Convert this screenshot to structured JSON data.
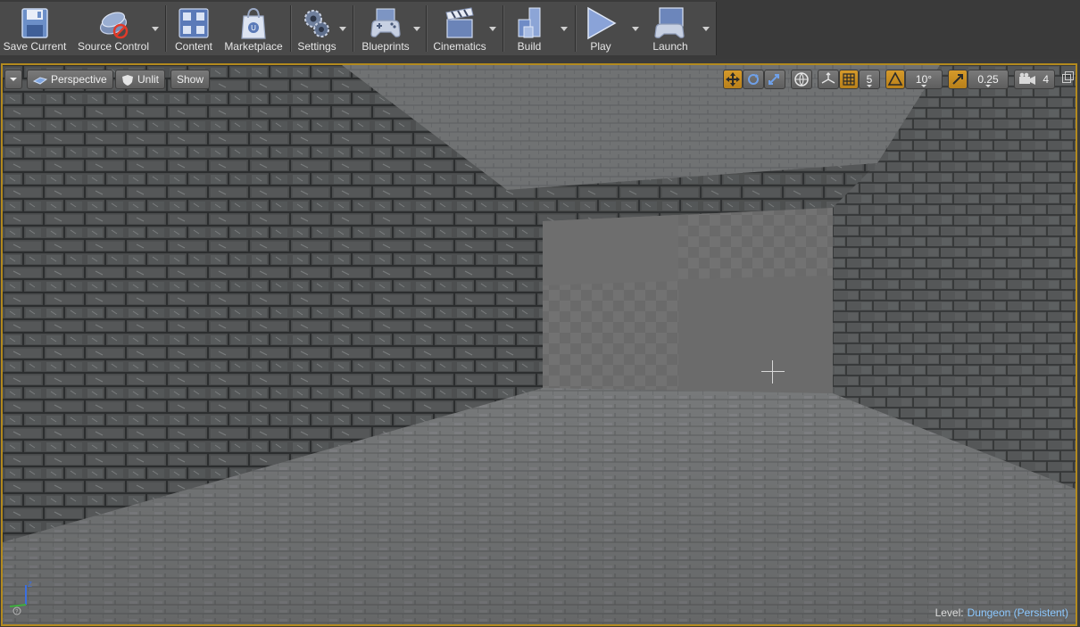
{
  "toolbar": {
    "buttons": [
      {
        "id": "save",
        "label": "Save Current",
        "icon": "floppy-disk-icon"
      },
      {
        "id": "source",
        "label": "Source Control",
        "icon": "source-control-icon",
        "has_menu": true
      },
      {
        "id": "content",
        "label": "Content",
        "icon": "content-browser-icon"
      },
      {
        "id": "marketplace",
        "label": "Marketplace",
        "icon": "marketplace-bag-icon"
      },
      {
        "id": "settings",
        "label": "Settings",
        "icon": "gears-icon",
        "has_menu": true
      },
      {
        "id": "blueprints",
        "label": "Blueprints",
        "icon": "gamepad-icon",
        "has_menu": true
      },
      {
        "id": "cinematics",
        "label": "Cinematics",
        "icon": "clapperboard-icon",
        "has_menu": true
      },
      {
        "id": "build",
        "label": "Build",
        "icon": "build-blocks-icon",
        "has_menu": true
      },
      {
        "id": "play",
        "label": "Play",
        "icon": "play-icon",
        "has_menu": true
      },
      {
        "id": "launch",
        "label": "Launch",
        "icon": "launch-monitor-icon",
        "has_menu": true
      }
    ]
  },
  "viewport": {
    "view_mode": "Perspective",
    "lit_mode": "Unlit",
    "show_label": "Show",
    "grid_snap": "5",
    "rotation_snap": "10°",
    "scale_snap": "0.25",
    "camera_speed": "4",
    "level_label": "Level:",
    "level_name": "Dungeon (Persistent)"
  },
  "colors": {
    "accent": "#b38a1e",
    "active_orange": "#d69a2a",
    "level_name": "#8cc8ff"
  }
}
